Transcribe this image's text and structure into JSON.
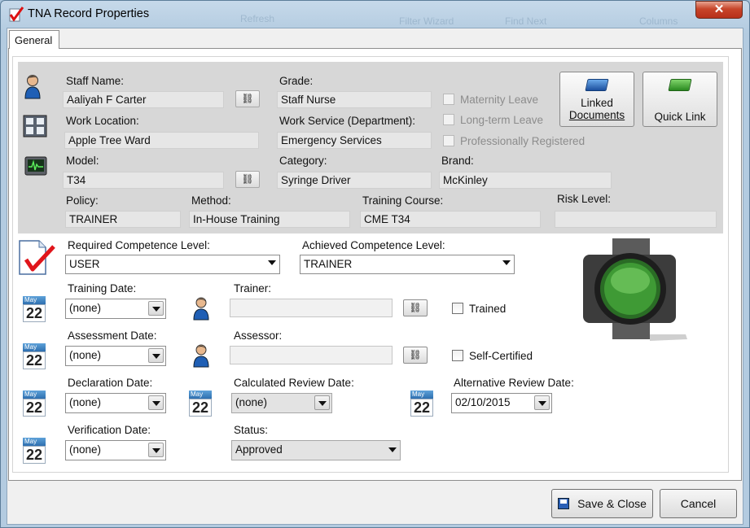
{
  "window": {
    "title": "TNA Record Properties",
    "close_glyph": "✕",
    "background_ghost": [
      "Refresh",
      "Filter Wizard",
      "Find Next",
      "Columns"
    ]
  },
  "tabs": [
    "General"
  ],
  "staff": {
    "staff_name_label": "Staff Name:",
    "staff_name": "Aaliyah F Carter",
    "grade_label": "Grade:",
    "grade": "Staff Nurse",
    "work_location_label": "Work Location:",
    "work_location": "Apple Tree Ward",
    "work_service_label": "Work Service (Department):",
    "work_service": "Emergency Services",
    "maternity_leave": "Maternity Leave",
    "long_term_leave": "Long-term Leave",
    "professionally_registered": "Professionally Registered"
  },
  "equipment": {
    "model_label": "Model:",
    "model": "T34",
    "category_label": "Category:",
    "category": "Syringe Driver",
    "brand_label": "Brand:",
    "brand": "McKinley"
  },
  "training": {
    "policy_label": "Policy:",
    "policy": "TRAINER",
    "method_label": "Method:",
    "method": "In-House Training",
    "course_label": "Training Course:",
    "course": "CME T34",
    "risk_label": "Risk Level:",
    "risk": ""
  },
  "buttons": {
    "linked_documents_1": "Linked",
    "linked_documents_2": "Documents",
    "quick_link": "Quick Link",
    "save_close": "Save & Close",
    "cancel": "Cancel"
  },
  "competence": {
    "required_label": "Required Competence Level:",
    "required": "USER",
    "achieved_label": "Achieved Competence Level:",
    "achieved": "TRAINER"
  },
  "dates": {
    "calendar_month": "May",
    "calendar_day": "22",
    "training_date_label": "Training Date:",
    "training_date": "(none)",
    "trainer_label": "Trainer:",
    "trained_label": "Trained",
    "assessment_date_label": "Assessment Date:",
    "assessment_date": "(none)",
    "assessor_label": "Assessor:",
    "self_certified_label": "Self-Certified",
    "declaration_date_label": "Declaration Date:",
    "declaration_date": "(none)",
    "calculated_review_label": "Calculated Review Date:",
    "calculated_review": "(none)",
    "alternative_review_label": "Alternative Review Date:",
    "alternative_review": "02/10/2015",
    "verification_date_label": "Verification Date:",
    "verification_date": "(none)",
    "status_label": "Status:",
    "status": "Approved"
  },
  "colors": {
    "traffic_light": "#3f9a35",
    "accent": "#2e6fb0"
  }
}
